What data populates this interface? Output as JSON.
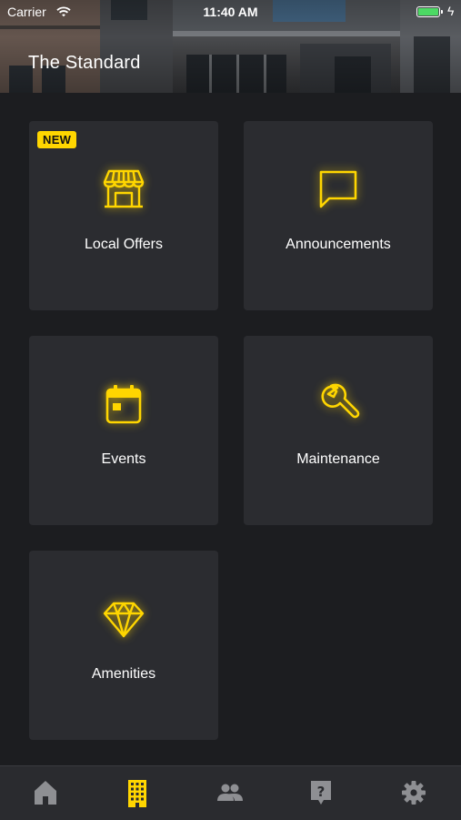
{
  "status_bar": {
    "carrier": "Carrier",
    "time": "11:40 AM",
    "battery_level": 1.0
  },
  "header": {
    "title": "The Standard"
  },
  "tiles": [
    {
      "label": "Local Offers",
      "icon": "storefront-icon",
      "badge": "NEW"
    },
    {
      "label": "Announcements",
      "icon": "chat-bubble-icon"
    },
    {
      "label": "Events",
      "icon": "calendar-icon"
    },
    {
      "label": "Maintenance",
      "icon": "wrench-icon"
    },
    {
      "label": "Amenities",
      "icon": "diamond-icon"
    }
  ],
  "tab_bar": {
    "items": [
      {
        "icon": "home-icon",
        "active": false
      },
      {
        "icon": "building-icon",
        "active": true
      },
      {
        "icon": "people-icon",
        "active": false
      },
      {
        "icon": "help-icon",
        "active": false
      },
      {
        "icon": "gear-icon",
        "active": false
      }
    ]
  },
  "colors": {
    "accent": "#ffd600",
    "background": "#1c1d20",
    "tile": "#2b2c30",
    "tab_inactive": "#8e8f93",
    "battery": "#4cd964"
  }
}
